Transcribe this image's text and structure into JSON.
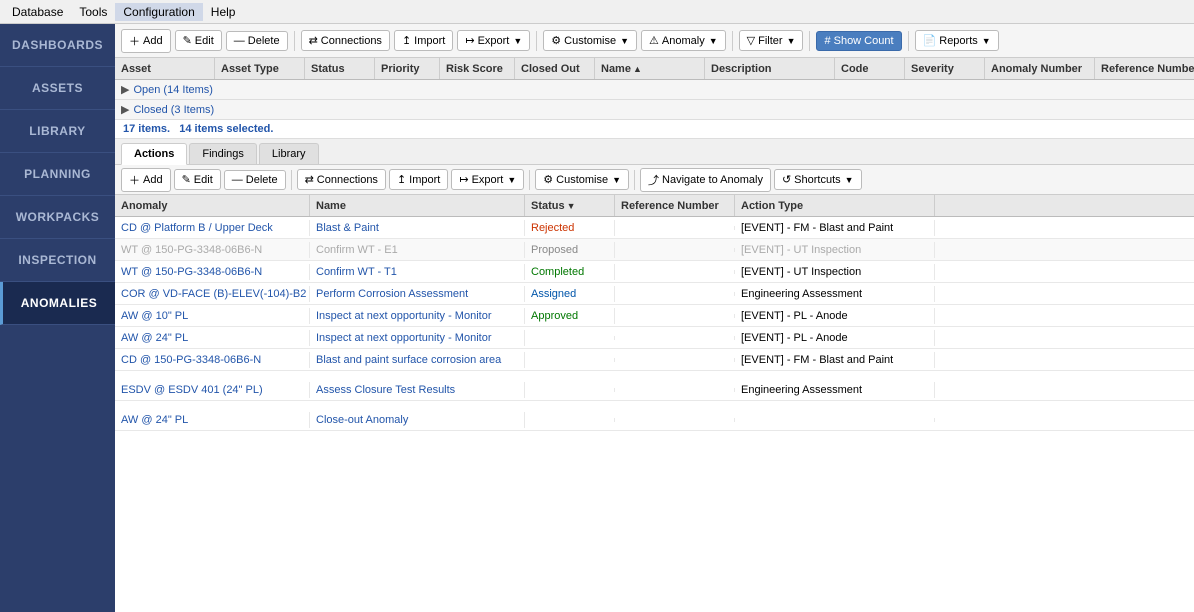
{
  "menu": {
    "items": [
      "Database",
      "Tools",
      "Configuration",
      "Help"
    ],
    "active": "Configuration"
  },
  "sidebar": {
    "items": [
      {
        "label": "DASHBOARDS",
        "id": "dashboards"
      },
      {
        "label": "ASSETS",
        "id": "assets"
      },
      {
        "label": "LIBRARY",
        "id": "library"
      },
      {
        "label": "PLANNING",
        "id": "planning"
      },
      {
        "label": "WORKPACKS",
        "id": "workpacks"
      },
      {
        "label": "INSPECTION",
        "id": "inspection"
      },
      {
        "label": "ANOMALIES",
        "id": "anomalies",
        "active": true
      }
    ]
  },
  "toolbar": {
    "add_label": "Add",
    "edit_label": "Edit",
    "delete_label": "Delete",
    "connections_label": "Connections",
    "import_label": "Import",
    "export_label": "Export",
    "customise_label": "Customise",
    "anomaly_label": "Anomaly",
    "filter_label": "Filter",
    "show_count_label": "Show Count",
    "reports_label": "Reports"
  },
  "table_headers": {
    "asset": "Asset",
    "asset_type": "Asset Type",
    "status": "Status",
    "priority": "Priority",
    "risk_score": "Risk Score",
    "closed_out": "Closed Out",
    "name": "Name",
    "description": "Description",
    "code": "Code",
    "severity": "Severity",
    "anomaly_number": "Anomaly Number",
    "reference_number": "Reference Number"
  },
  "groups": [
    {
      "label": "Open (14 Items)",
      "expanded": true
    },
    {
      "label": "Closed (3 Items)",
      "expanded": false
    }
  ],
  "summary": {
    "total": "17 items.",
    "selected": "14 items selected."
  },
  "tabs": [
    {
      "label": "Actions",
      "active": true
    },
    {
      "label": "Findings"
    },
    {
      "label": "Library"
    }
  ],
  "sub_toolbar": {
    "add_label": "Add",
    "edit_label": "Edit",
    "delete_label": "Delete",
    "connections_label": "Connections",
    "import_label": "Import",
    "export_label": "Export",
    "customise_label": "Customise",
    "navigate_label": "Navigate to Anomaly",
    "shortcuts_label": "Shortcuts"
  },
  "actions_headers": {
    "anomaly": "Anomaly",
    "name": "Name",
    "status": "Status",
    "reference_number": "Reference Number",
    "action_type": "Action Type"
  },
  "actions_rows": [
    {
      "anomaly": "CD @ Platform B / Upper Deck",
      "name": "Blast & Paint",
      "status": "Rejected",
      "status_class": "status-rejected",
      "reference_number": "",
      "action_type": "[EVENT] - FM - Blast and Paint",
      "dimmed": false,
      "selected": false
    },
    {
      "anomaly": "WT @ 150-PG-3348-06B6-N",
      "name": "Confirm WT - E1",
      "status": "Proposed",
      "status_class": "status-proposed",
      "reference_number": "",
      "action_type": "[EVENT] - UT Inspection",
      "dimmed": true,
      "selected": false
    },
    {
      "anomaly": "WT @ 150-PG-3348-06B6-N",
      "name": "Confirm WT - T1",
      "status": "Completed",
      "status_class": "status-completed",
      "reference_number": "",
      "action_type": "[EVENT] - UT Inspection",
      "dimmed": false,
      "selected": false
    },
    {
      "anomaly": "COR @ VD-FACE (B)-ELEV(-104)-B2",
      "name": "Perform Corrosion Assessment",
      "status": "Assigned",
      "status_class": "status-assigned",
      "reference_number": "",
      "action_type": "Engineering Assessment",
      "dimmed": false,
      "selected": false
    },
    {
      "anomaly": "AW @ 10\" PL",
      "name": "Inspect at next opportunity - Monitor",
      "status": "Approved",
      "status_class": "status-approved",
      "reference_number": "",
      "action_type": "[EVENT] - PL - Anode",
      "dimmed": false,
      "selected": false
    },
    {
      "anomaly": "AW @ 24\" PL",
      "name": "Inspect at next opportunity - Monitor",
      "status": "",
      "status_class": "",
      "reference_number": "",
      "action_type": "[EVENT] - PL - Anode",
      "dimmed": false,
      "selected": false
    },
    {
      "anomaly": "CD @ 150-PG-3348-06B6-N",
      "name": "Blast and paint surface corrosion area",
      "status": "",
      "status_class": "",
      "reference_number": "",
      "action_type": "[EVENT] - FM - Blast and Paint",
      "dimmed": false,
      "selected": false
    },
    {
      "anomaly": "",
      "name": "",
      "status": "",
      "status_class": "",
      "reference_number": "",
      "action_type": "",
      "dimmed": false,
      "selected": false,
      "spacer": true
    },
    {
      "anomaly": "ESDV @ ESDV 401 (24\" PL)",
      "name": "Assess Closure Test Results",
      "status": "",
      "status_class": "",
      "reference_number": "",
      "action_type": "Engineering Assessment",
      "dimmed": false,
      "selected": false
    },
    {
      "anomaly": "",
      "name": "",
      "status": "",
      "status_class": "",
      "reference_number": "",
      "action_type": "",
      "dimmed": false,
      "selected": false,
      "spacer": true
    },
    {
      "anomaly": "AW @ 24\" PL",
      "name": "Close-out Anomaly",
      "status": "",
      "status_class": "",
      "reference_number": "",
      "action_type": "",
      "dimmed": false,
      "selected": false
    }
  ]
}
